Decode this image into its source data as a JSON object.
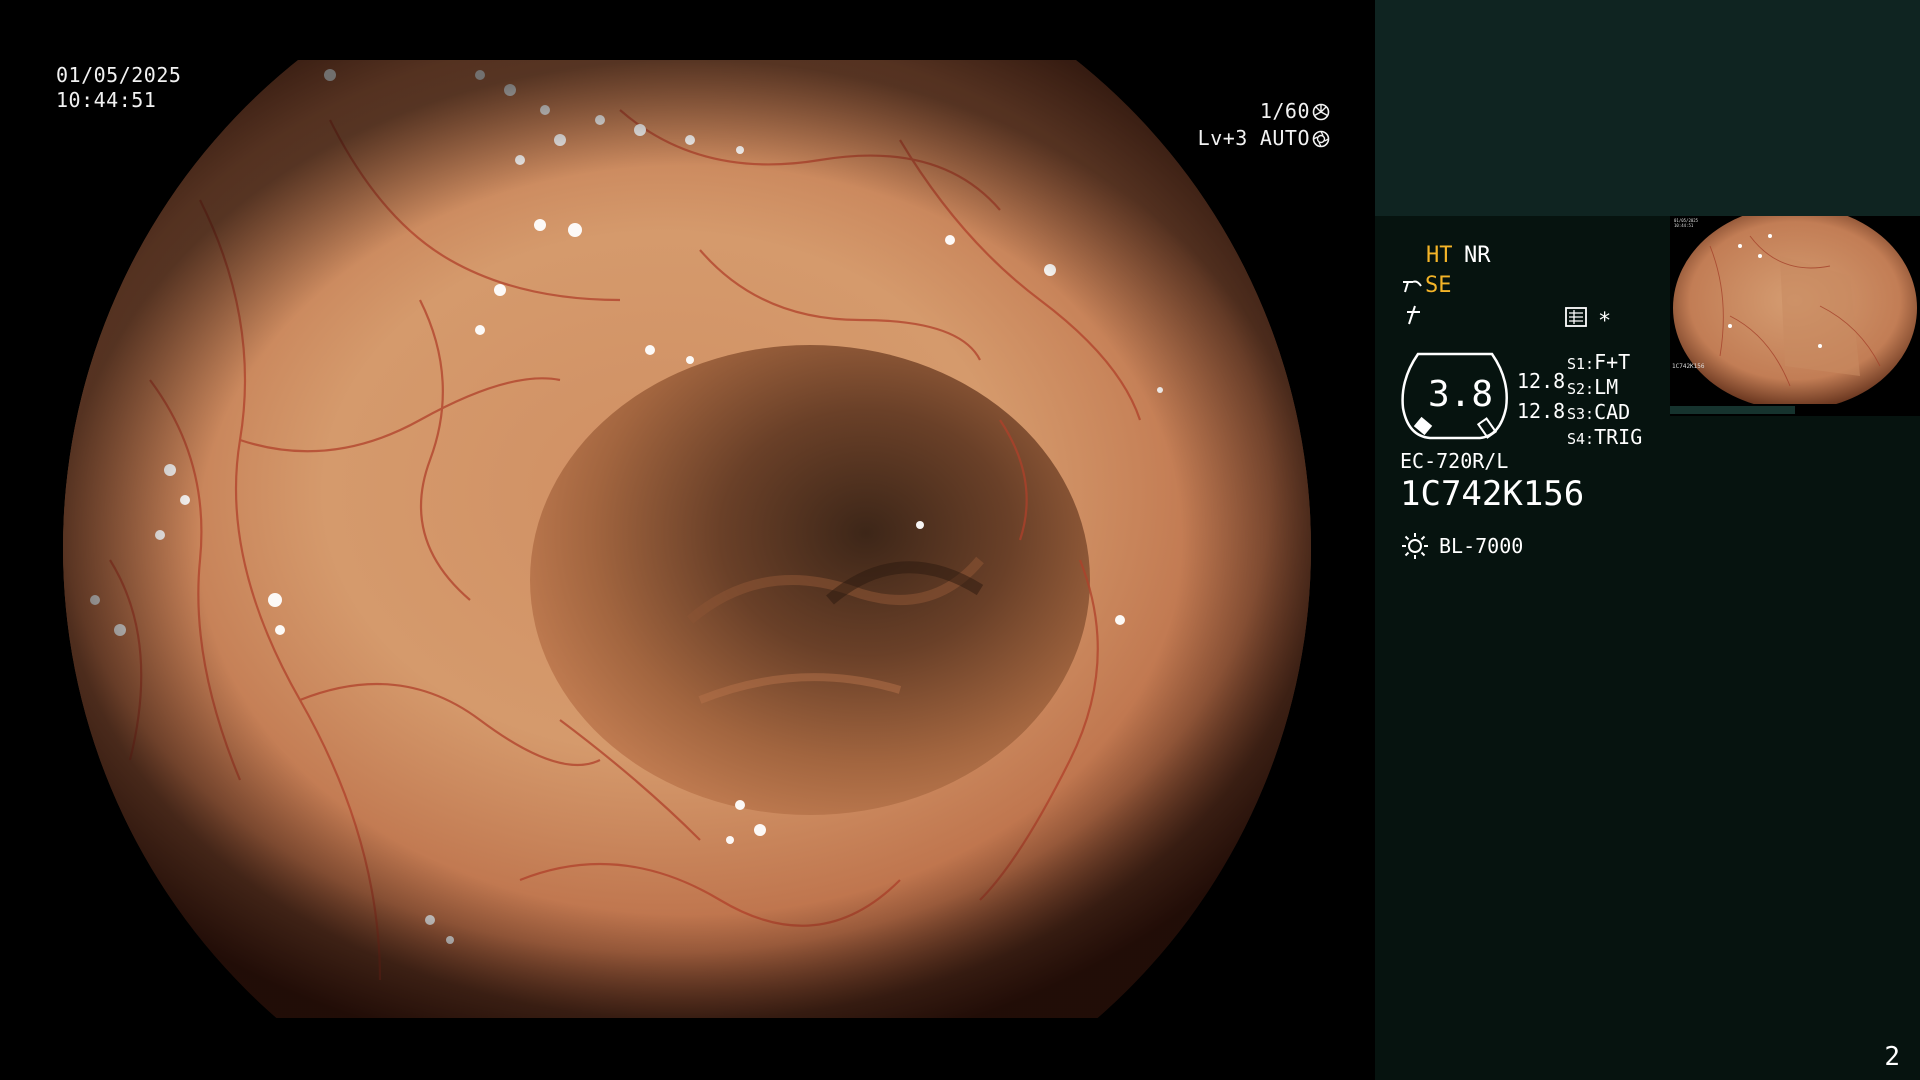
{
  "overlay": {
    "date": "01/05/2025",
    "time": "10:44:51",
    "shutter": "1/60",
    "shutter_icon": "aperture-icon",
    "level": "Lv+3",
    "exposure_mode": "AUTO",
    "exposure_icon": "iris-icon"
  },
  "settings": {
    "ht": "HT",
    "nr": "NR",
    "se": "SE",
    "star": "*",
    "ht_color": "#f4b428",
    "se_color": "#f4b428"
  },
  "zoom": {
    "value": "3.8",
    "top": "12.8",
    "bottom": "12.8"
  },
  "switches": [
    {
      "key": "S1:",
      "value": "F+T"
    },
    {
      "key": "S2:",
      "value": "LM"
    },
    {
      "key": "S3:",
      "value": "CAD"
    },
    {
      "key": "S4:",
      "value": "TRIG"
    }
  ],
  "scope": {
    "model": "EC-720R/L",
    "serial": "1C742K156",
    "light_source": "BL-7000"
  },
  "thumbnail": {
    "date": "01/05/2025",
    "time": "10:44:51",
    "serial": "1C742K156"
  },
  "page_number": "2",
  "colors": {
    "panel_top": "#0f2421",
    "panel_bottom": "#06130f",
    "accent": "#f4b428"
  }
}
